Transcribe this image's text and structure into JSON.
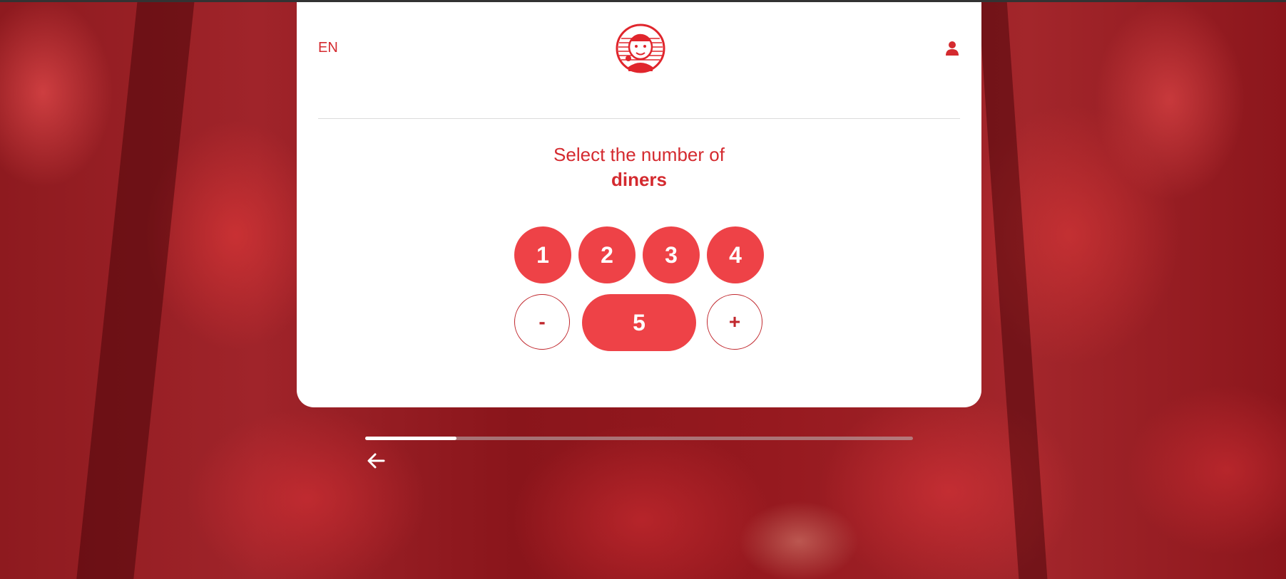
{
  "header": {
    "language": "EN",
    "logo_icon": "restaurant-logo-icon",
    "account_icon": "user-icon"
  },
  "selector": {
    "title_line1": "Select the number of",
    "title_line2": "diners",
    "options": [
      "1",
      "2",
      "3",
      "4"
    ],
    "decrement_label": "-",
    "increment_label": "+",
    "current_value": "5"
  },
  "progress": {
    "fraction": 0.167
  },
  "navigation": {
    "back_icon": "arrow-left-icon"
  },
  "colors": {
    "accent": "#ee4247",
    "text_red": "#d42a2f",
    "outline": "#c0272d",
    "card": "#ffffff"
  }
}
